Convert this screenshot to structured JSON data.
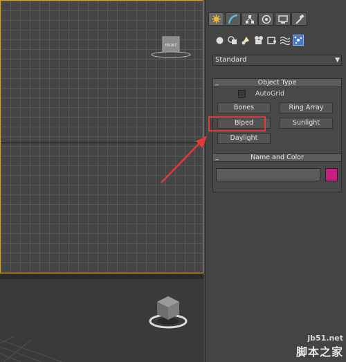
{
  "viewport_top": {
    "viewcube_label": "FRONT"
  },
  "command_panel": {
    "tabs": [
      {
        "name": "create",
        "icon": "create-icon"
      },
      {
        "name": "modify",
        "icon": "modify-icon"
      },
      {
        "name": "hierarchy",
        "icon": "hierarchy-icon"
      },
      {
        "name": "motion",
        "icon": "motion-icon"
      },
      {
        "name": "display",
        "icon": "display-icon"
      },
      {
        "name": "utilities",
        "icon": "utilities-icon"
      }
    ],
    "categories": [
      "geometry-icon",
      "shapes-icon",
      "lights-icon",
      "cameras-icon",
      "helpers-icon",
      "spacewarps-icon",
      "systems-icon"
    ],
    "dropdown_value": "Standard",
    "object_type": {
      "title": "Object Type",
      "autogrid_label": "AutoGrid",
      "buttons": {
        "bones": "Bones",
        "ring_array": "Ring Array",
        "biped": "Biped",
        "sunlight": "Sunlight",
        "daylight": "Daylight"
      }
    },
    "name_and_color": {
      "title": "Name and Color",
      "name_value": "",
      "color": "#c4207f"
    }
  },
  "collapse_glyph": "_",
  "watermark": {
    "site": "jb51.net",
    "text": "脚本之家"
  },
  "colors": {
    "accent_highlight": "#e23a3a",
    "viewport_border": "#c8a23a"
  }
}
